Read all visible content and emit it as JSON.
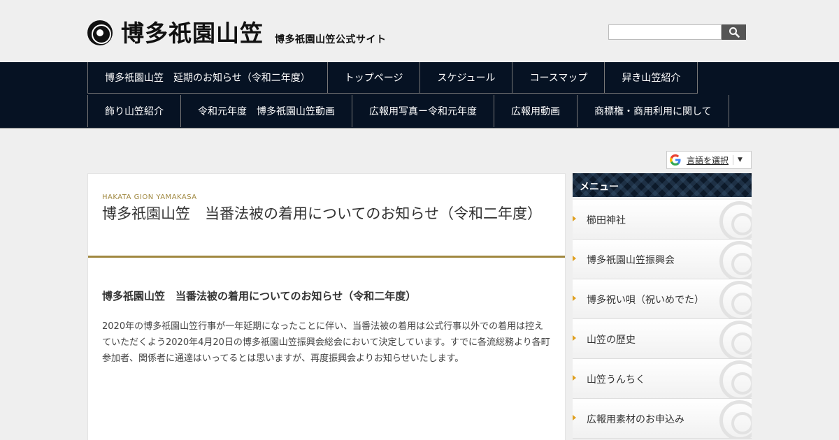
{
  "header": {
    "site_title": "博多祇園山笠",
    "site_subtitle": "博多祇園山笠公式サイト",
    "search": {
      "placeholder": "",
      "button_icon": "search-icon"
    }
  },
  "nav": {
    "row1": [
      "博多祇園山笠　延期のお知らせ（令和二年度）",
      "トップページ",
      "スケジュール",
      "コースマップ",
      "舁き山笠紹介"
    ],
    "row2": [
      "飾り山笠紹介",
      "令和元年度　博多祇園山笠動画",
      "広報用写真ー令和元年度",
      "広報用動画",
      "商標権・商用利用に関して"
    ]
  },
  "translate": {
    "label": "言語を選択",
    "arrow": "▼"
  },
  "article": {
    "kicker": "HAKATA GION YAMAKASA",
    "title": "博多祇園山笠　当番法被の着用についてのお知らせ（令和二年度）",
    "heading": "博多祇園山笠　当番法被の着用についてのお知らせ（令和二年度）",
    "body": "2020年の博多祇園山笠行事が一年延期になったことに伴い、当番法被の着用は公式行事以外での着用は控えていただくよう2020年4月20日の博多祇園山笠振興会総会において決定しています。すでに各流総務より各町参加者、関係者に通達はいってるとは思いますが、再度振興会よりお知らせいたします。"
  },
  "sidebar": {
    "title": "メニュー",
    "items": [
      "櫛田神社",
      "博多祇園山笠振興会",
      "博多祝い唄（祝いめでた）",
      "山笠の歴史",
      "山笠うんちく",
      "広報用素材のお申込み"
    ]
  },
  "colors": {
    "nav_bg": "#061223",
    "accent_gold": "#a08840",
    "bullet": "#e0a020"
  }
}
